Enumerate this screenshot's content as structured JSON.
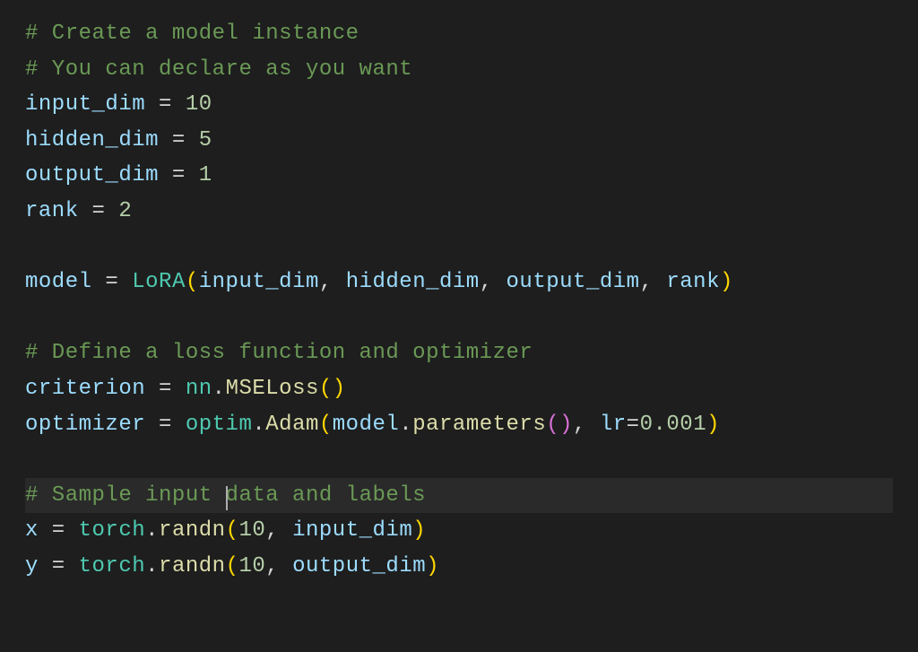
{
  "code": {
    "comments": {
      "c1": "# Create a model instance",
      "c2": "# You can declare as you want",
      "c3": "# Define a loss function and optimizer",
      "c4a": "# Sample input ",
      "c4b": "data and labels"
    },
    "vars": {
      "input_dim": "input_dim",
      "hidden_dim": "hidden_dim",
      "output_dim": "output_dim",
      "rank": "rank",
      "model": "model",
      "criterion": "criterion",
      "optimizer": "optimizer",
      "x": "x",
      "y": "y"
    },
    "sym": {
      "eq": " = ",
      "dot": ".",
      "comma_sp": ", ",
      "lr_kw": "lr"
    },
    "nums": {
      "ten": "10",
      "five": "5",
      "one": "1",
      "two": "2",
      "lr": "0.001"
    },
    "ids": {
      "LoRA": "LoRA",
      "nn": "nn",
      "MSELoss": "MSELoss",
      "optim": "optim",
      "Adam": "Adam",
      "parameters": "parameters",
      "torch": "torch",
      "randn": "randn"
    }
  }
}
